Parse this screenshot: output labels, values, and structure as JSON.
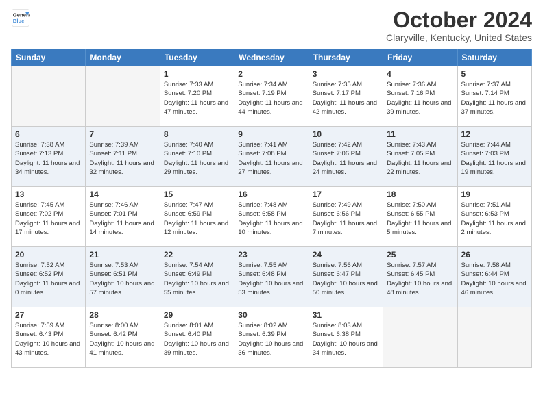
{
  "header": {
    "logo_line1": "General",
    "logo_line2": "Blue",
    "month": "October 2024",
    "location": "Claryville, Kentucky, United States"
  },
  "days_of_week": [
    "Sunday",
    "Monday",
    "Tuesday",
    "Wednesday",
    "Thursday",
    "Friday",
    "Saturday"
  ],
  "weeks": [
    [
      {
        "day": "",
        "info": ""
      },
      {
        "day": "",
        "info": ""
      },
      {
        "day": "1",
        "info": "Sunrise: 7:33 AM\nSunset: 7:20 PM\nDaylight: 11 hours and 47 minutes."
      },
      {
        "day": "2",
        "info": "Sunrise: 7:34 AM\nSunset: 7:19 PM\nDaylight: 11 hours and 44 minutes."
      },
      {
        "day": "3",
        "info": "Sunrise: 7:35 AM\nSunset: 7:17 PM\nDaylight: 11 hours and 42 minutes."
      },
      {
        "day": "4",
        "info": "Sunrise: 7:36 AM\nSunset: 7:16 PM\nDaylight: 11 hours and 39 minutes."
      },
      {
        "day": "5",
        "info": "Sunrise: 7:37 AM\nSunset: 7:14 PM\nDaylight: 11 hours and 37 minutes."
      }
    ],
    [
      {
        "day": "6",
        "info": "Sunrise: 7:38 AM\nSunset: 7:13 PM\nDaylight: 11 hours and 34 minutes."
      },
      {
        "day": "7",
        "info": "Sunrise: 7:39 AM\nSunset: 7:11 PM\nDaylight: 11 hours and 32 minutes."
      },
      {
        "day": "8",
        "info": "Sunrise: 7:40 AM\nSunset: 7:10 PM\nDaylight: 11 hours and 29 minutes."
      },
      {
        "day": "9",
        "info": "Sunrise: 7:41 AM\nSunset: 7:08 PM\nDaylight: 11 hours and 27 minutes."
      },
      {
        "day": "10",
        "info": "Sunrise: 7:42 AM\nSunset: 7:06 PM\nDaylight: 11 hours and 24 minutes."
      },
      {
        "day": "11",
        "info": "Sunrise: 7:43 AM\nSunset: 7:05 PM\nDaylight: 11 hours and 22 minutes."
      },
      {
        "day": "12",
        "info": "Sunrise: 7:44 AM\nSunset: 7:03 PM\nDaylight: 11 hours and 19 minutes."
      }
    ],
    [
      {
        "day": "13",
        "info": "Sunrise: 7:45 AM\nSunset: 7:02 PM\nDaylight: 11 hours and 17 minutes."
      },
      {
        "day": "14",
        "info": "Sunrise: 7:46 AM\nSunset: 7:01 PM\nDaylight: 11 hours and 14 minutes."
      },
      {
        "day": "15",
        "info": "Sunrise: 7:47 AM\nSunset: 6:59 PM\nDaylight: 11 hours and 12 minutes."
      },
      {
        "day": "16",
        "info": "Sunrise: 7:48 AM\nSunset: 6:58 PM\nDaylight: 11 hours and 10 minutes."
      },
      {
        "day": "17",
        "info": "Sunrise: 7:49 AM\nSunset: 6:56 PM\nDaylight: 11 hours and 7 minutes."
      },
      {
        "day": "18",
        "info": "Sunrise: 7:50 AM\nSunset: 6:55 PM\nDaylight: 11 hours and 5 minutes."
      },
      {
        "day": "19",
        "info": "Sunrise: 7:51 AM\nSunset: 6:53 PM\nDaylight: 11 hours and 2 minutes."
      }
    ],
    [
      {
        "day": "20",
        "info": "Sunrise: 7:52 AM\nSunset: 6:52 PM\nDaylight: 11 hours and 0 minutes."
      },
      {
        "day": "21",
        "info": "Sunrise: 7:53 AM\nSunset: 6:51 PM\nDaylight: 10 hours and 57 minutes."
      },
      {
        "day": "22",
        "info": "Sunrise: 7:54 AM\nSunset: 6:49 PM\nDaylight: 10 hours and 55 minutes."
      },
      {
        "day": "23",
        "info": "Sunrise: 7:55 AM\nSunset: 6:48 PM\nDaylight: 10 hours and 53 minutes."
      },
      {
        "day": "24",
        "info": "Sunrise: 7:56 AM\nSunset: 6:47 PM\nDaylight: 10 hours and 50 minutes."
      },
      {
        "day": "25",
        "info": "Sunrise: 7:57 AM\nSunset: 6:45 PM\nDaylight: 10 hours and 48 minutes."
      },
      {
        "day": "26",
        "info": "Sunrise: 7:58 AM\nSunset: 6:44 PM\nDaylight: 10 hours and 46 minutes."
      }
    ],
    [
      {
        "day": "27",
        "info": "Sunrise: 7:59 AM\nSunset: 6:43 PM\nDaylight: 10 hours and 43 minutes."
      },
      {
        "day": "28",
        "info": "Sunrise: 8:00 AM\nSunset: 6:42 PM\nDaylight: 10 hours and 41 minutes."
      },
      {
        "day": "29",
        "info": "Sunrise: 8:01 AM\nSunset: 6:40 PM\nDaylight: 10 hours and 39 minutes."
      },
      {
        "day": "30",
        "info": "Sunrise: 8:02 AM\nSunset: 6:39 PM\nDaylight: 10 hours and 36 minutes."
      },
      {
        "day": "31",
        "info": "Sunrise: 8:03 AM\nSunset: 6:38 PM\nDaylight: 10 hours and 34 minutes."
      },
      {
        "day": "",
        "info": ""
      },
      {
        "day": "",
        "info": ""
      }
    ]
  ]
}
